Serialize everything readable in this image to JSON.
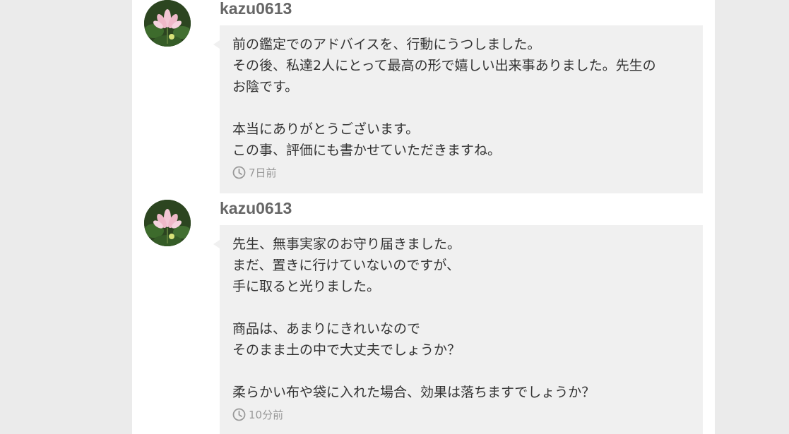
{
  "messages": [
    {
      "username": "kazu0613",
      "lines": [
        "前の鑑定でのアドバイスを、行動にうつしました。",
        "その後、私達2人にとって最高の形で嬉しい出来事ありました。先生の",
        "お陰です。",
        "",
        "本当にありがとうございます。",
        "この事、評価にも書かせていただきますね。"
      ],
      "time": "7日前"
    },
    {
      "username": "kazu0613",
      "lines": [
        "先生、無事実家のお守り届きました。",
        "まだ、置きに行けていないのですが、",
        "手に取ると光りました。",
        "",
        "商品は、あまりにきれいなので",
        "そのまま土の中で大丈夫でしょうか？",
        "",
        "柔らかい布や袋に入れた場合、効果は落ちますでしょうか？"
      ],
      "time": "10分前"
    }
  ],
  "icons": {
    "avatar": "lotus-flower-avatar-icon",
    "timestamp": "clock-icon"
  },
  "colors": {
    "page_background": "#ebebeb",
    "panel_background": "#ffffff",
    "bubble_background": "#f0f0f0",
    "username": "#666666",
    "message_text": "#333333",
    "timestamp": "#999999"
  }
}
